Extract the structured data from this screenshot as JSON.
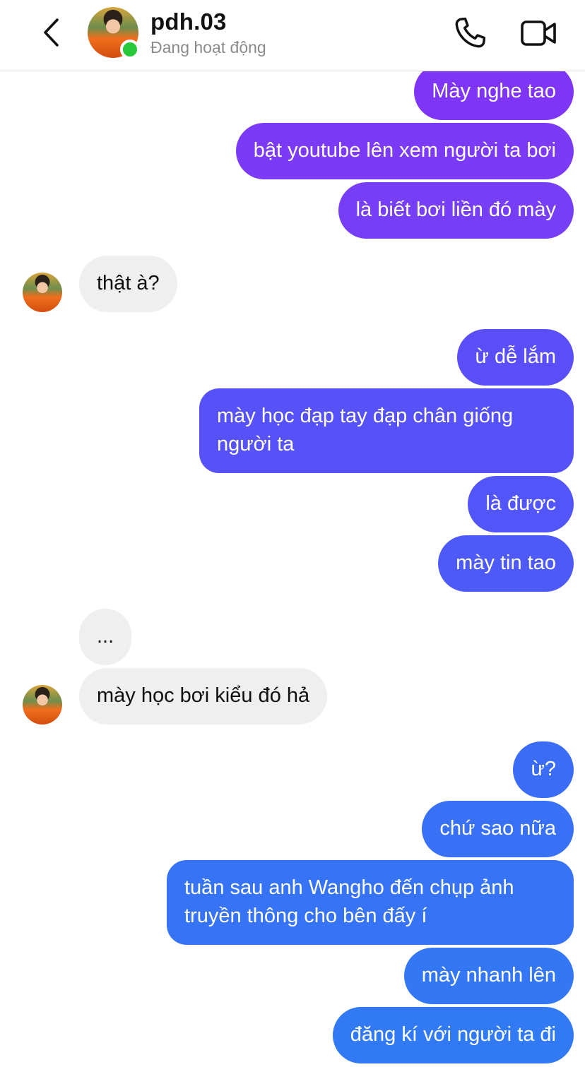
{
  "header": {
    "name": "pdh.03",
    "status": "Đang hoạt động",
    "icons": {
      "back": "chevron-left-icon",
      "call": "phone-icon",
      "video": "video-camera-icon"
    },
    "online_color": "#27c93a"
  },
  "messages": [
    {
      "side": "out",
      "text": "Mày nghe tao",
      "color": "#7f35f5"
    },
    {
      "side": "out",
      "text": "bật youtube lên xem người ta bơi",
      "color": "#7b3af5"
    },
    {
      "side": "out",
      "text": "là biết bơi liền đó mày",
      "color": "#763ff6"
    },
    {
      "side": "in",
      "text": "thật à?"
    },
    {
      "side": "out",
      "text": "ừ dễ lắm",
      "color": "#5a4ef8"
    },
    {
      "side": "out",
      "text": "mày học đạp tay đạp chân giống người ta",
      "color": "#5652f8"
    },
    {
      "side": "out",
      "text": "là được",
      "color": "#5256f8"
    },
    {
      "side": "out",
      "text": "mày tin tao",
      "color": "#4e5af8"
    },
    {
      "side": "in",
      "text": "..."
    },
    {
      "side": "in",
      "text": "mày học bơi kiểu đó hả"
    },
    {
      "side": "out",
      "text": "ừ?",
      "color": "#3a6cf6"
    },
    {
      "side": "out",
      "text": "chứ sao nữa",
      "color": "#3870f6"
    },
    {
      "side": "out",
      "text": "tuần sau anh Wangho đến chụp ảnh truyền thông cho bên đấy í",
      "color": "#3674f5"
    },
    {
      "side": "out",
      "text": "mày nhanh lên",
      "color": "#3377f4"
    },
    {
      "side": "out",
      "text": "đăng kí với người ta đi",
      "color": "#317af4"
    }
  ],
  "incoming_bubble_color": "#efefef"
}
